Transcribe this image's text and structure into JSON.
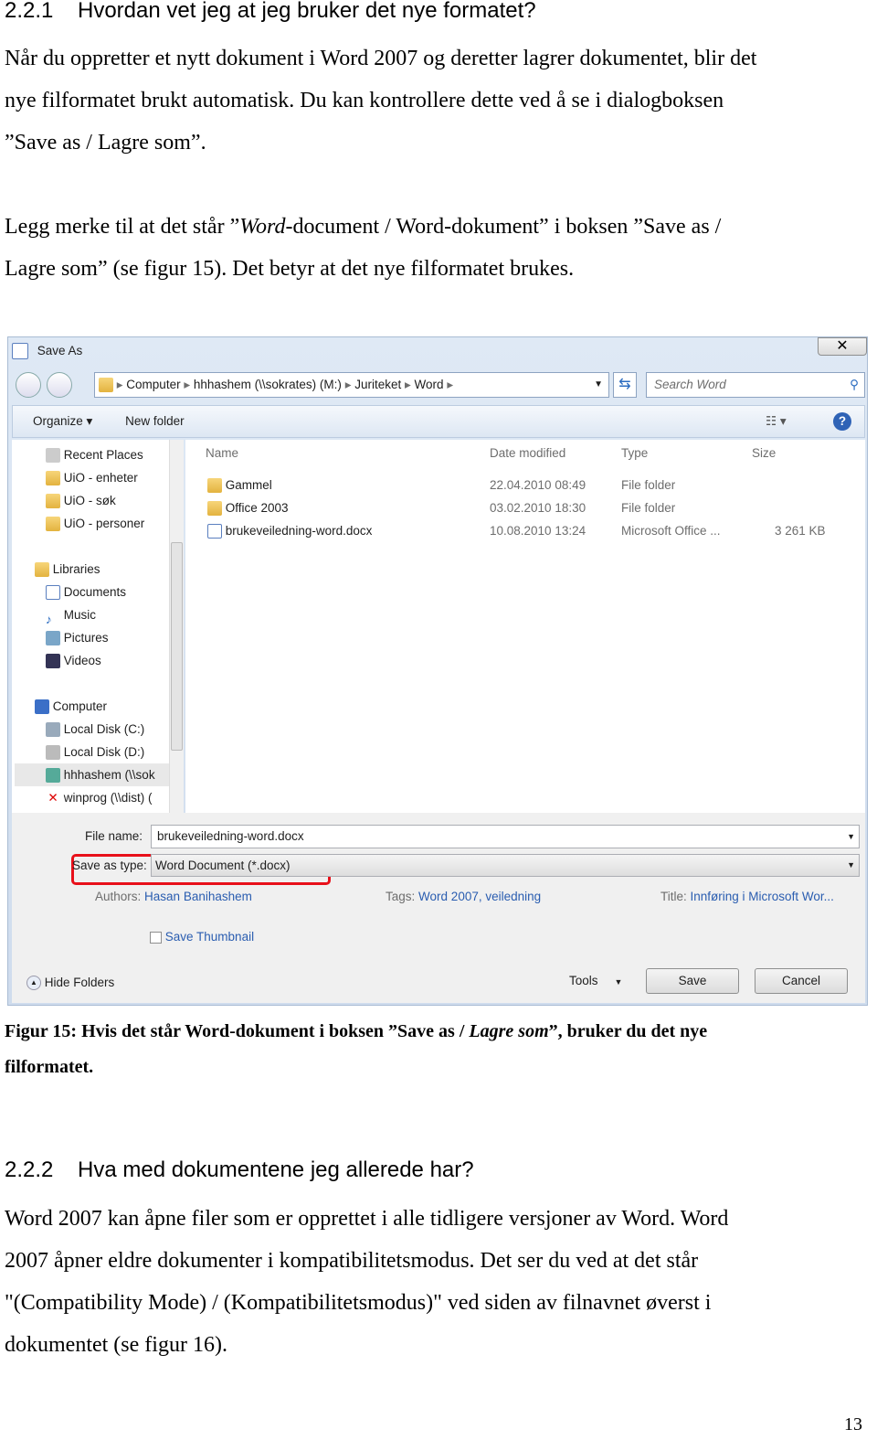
{
  "section1": {
    "number": "2.2.1",
    "title": "Hvordan vet jeg at jeg bruker det nye formatet?"
  },
  "para1": [
    "Når du oppretter et nytt dokument i Word 2007 og deretter lagrer dokumentet, blir det",
    "nye filformatet brukt automatisk.  Du kan kontrollere dette ved å se i dialogboksen",
    "”Save as / Lagre som”."
  ],
  "para2": {
    "l1a": "Legg merke til at det står ”",
    "l1b": "Word",
    "l1c": "-document / Word-dokument” i boksen ”Save as /",
    "l2": "Lagre som” (se figur 15). Det betyr at det nye filformatet brukes."
  },
  "dialog": {
    "title": "Save As",
    "close_icon": "close-icon",
    "breadcrumb": [
      "Computer",
      "hhhashem (\\\\sokrates) (M:)",
      "Juriteket",
      "Word"
    ],
    "search_placeholder": "Search Word",
    "toolbar": {
      "organize": "Organize ▾",
      "new_folder": "New folder"
    },
    "nav": {
      "favorites": [
        "Recent Places",
        "UiO - enheter",
        "UiO - søk",
        "UiO - personer"
      ],
      "libraries": "Libraries",
      "library_items": [
        "Documents",
        "Music",
        "Pictures",
        "Videos"
      ],
      "computer": "Computer",
      "computer_items": [
        "Local Disk (C:)",
        "Local Disk (D:)",
        "hhhashem (\\\\sok",
        "winprog (\\\\dist) ("
      ]
    },
    "columns": {
      "name": "Name",
      "date": "Date modified",
      "type": "Type",
      "size": "Size"
    },
    "files": [
      {
        "name": "Gammel",
        "date": "22.04.2010 08:49",
        "type": "File folder",
        "size": "",
        "icon": "folder"
      },
      {
        "name": "Office 2003",
        "date": "03.02.2010 18:30",
        "type": "File folder",
        "size": "",
        "icon": "folder"
      },
      {
        "name": "brukeveiledning-word.docx",
        "date": "10.08.2010 13:24",
        "type": "Microsoft Office ...",
        "size": "3 261 KB",
        "icon": "word-doc"
      }
    ],
    "file_name_label": "File name:",
    "file_name": "brukeveiledning-word.docx",
    "save_type_label": "Save as type:",
    "save_type": "Word Document (*.docx)",
    "authors_label": "Authors:",
    "authors": "Hasan Banihashem",
    "tags_label": "Tags:",
    "tags": "Word 2007, veiledning",
    "title_label": "Title:",
    "title_value": "Innføring i Microsoft Wor...",
    "save_thumbnail": "Save Thumbnail",
    "hide_folders": "Hide Folders",
    "tools": "Tools",
    "save": "Save",
    "cancel": "Cancel",
    "highlight_color": "#e8101a"
  },
  "caption": {
    "a": "Figur 15: Hvis det står Word-dokument i boksen ”Save as / ",
    "b": "Lagre som",
    "c": "”, bruker du det nye",
    "d": "filformatet."
  },
  "section2": {
    "number": "2.2.2",
    "title": "Hva med dokumentene jeg allerede har?"
  },
  "para3": [
    "Word 2007 kan åpne filer som er opprettet i alle tidligere versjoner av Word.  Word",
    "2007 åpner eldre dokumenter i kompatibilitetsmodus. Det ser du ved at det står",
    "\"(Compatibility Mode) / (Kompatibilitetsmodus)\" ved siden av filnavnet øverst i",
    "dokumentet (se figur 16)."
  ],
  "page_number": "13"
}
